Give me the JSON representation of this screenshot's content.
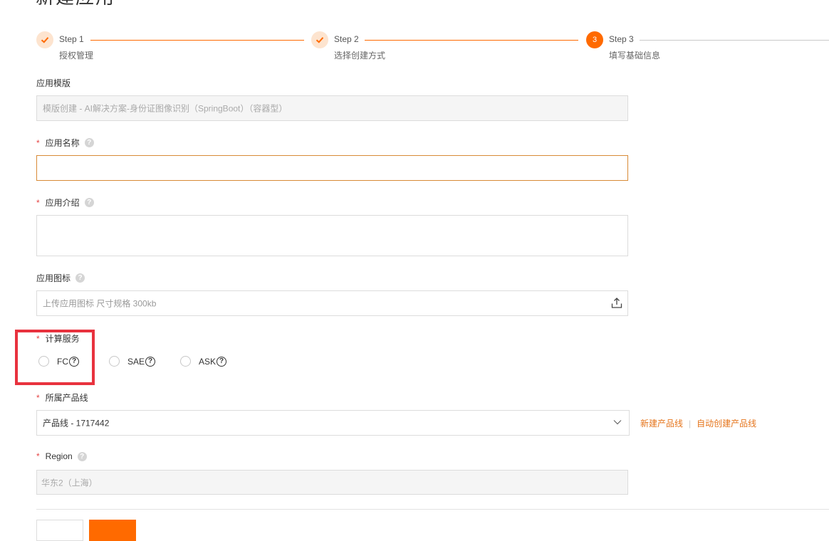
{
  "page": {
    "title": "新建应用"
  },
  "steps": [
    {
      "title": "Step 1",
      "desc": "授权管理",
      "status": "done"
    },
    {
      "title": "Step 2",
      "desc": "选择创建方式",
      "status": "done"
    },
    {
      "title": "Step 3",
      "desc": "填写基础信息",
      "status": "active",
      "number": "3"
    }
  ],
  "form": {
    "template": {
      "label": "应用模版",
      "value": "模版创建 - AI解决方案-身份证图像识别（SpringBoot）（容器型）"
    },
    "app_name": {
      "label": "应用名称",
      "value": ""
    },
    "app_intro": {
      "label": "应用介绍",
      "value": ""
    },
    "app_icon": {
      "label": "应用图标",
      "placeholder": "上传应用图标 尺寸规格 300kb"
    },
    "compute": {
      "label": "计算服务",
      "options": [
        {
          "label": "FC"
        },
        {
          "label": "SAE"
        },
        {
          "label": "ASK"
        }
      ]
    },
    "product_line": {
      "label": "所属产品线",
      "value": "产品线 - 1717442",
      "links": {
        "new": "新建产品线",
        "auto": "自动创建产品线"
      }
    },
    "region": {
      "label": "Region",
      "value": "华东2（上海）"
    }
  },
  "colors": {
    "accent": "#ff6a00",
    "highlight": "#e8323e"
  }
}
